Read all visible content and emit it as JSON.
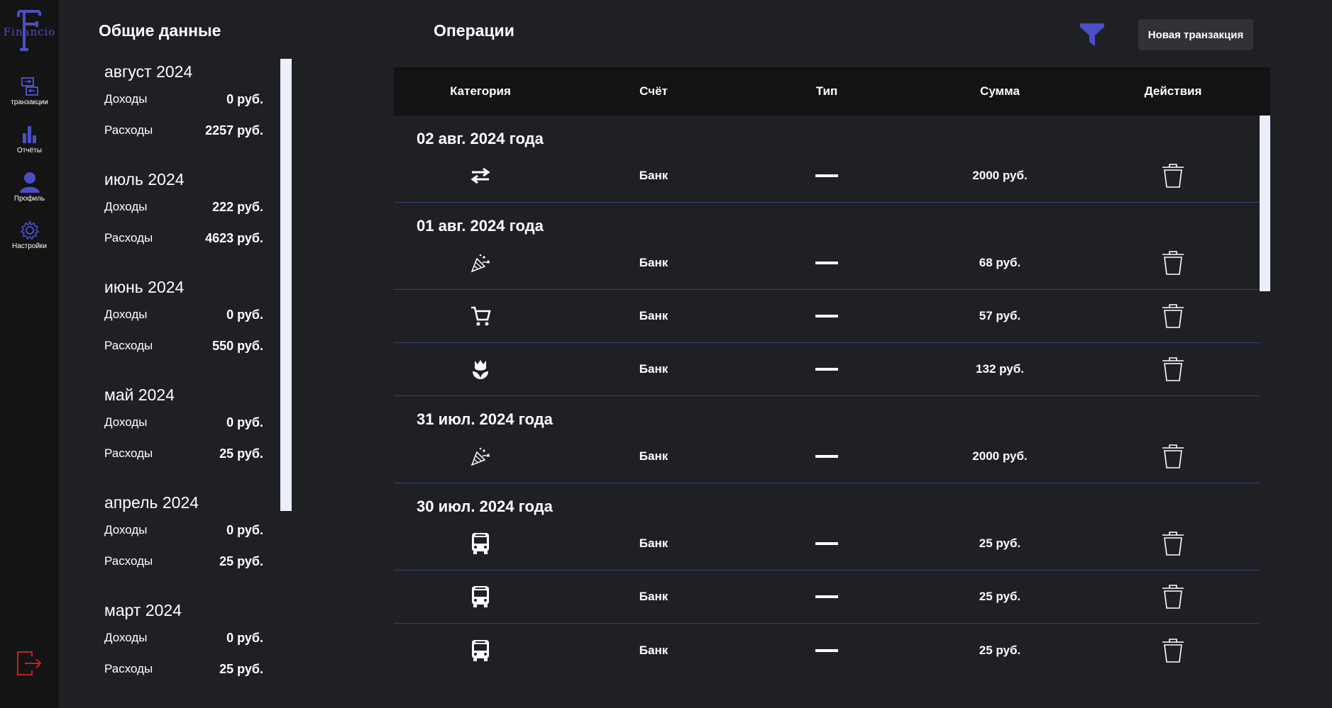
{
  "app": {
    "logo_text": "Financio",
    "logo_letter": "F",
    "accent": "#4b4fc6",
    "danger": "#c8201f"
  },
  "sidebar": {
    "items": [
      {
        "label": "транзакции",
        "icon": "transactions-icon"
      },
      {
        "label": "Отчёты",
        "icon": "bar-chart-icon"
      },
      {
        "label": "Профиль",
        "icon": "user-icon"
      },
      {
        "label": "Настройки",
        "icon": "gear-icon"
      }
    ],
    "logout_icon": "logout-icon"
  },
  "summary": {
    "title": "Общие данные",
    "months": [
      {
        "name": "август 2024",
        "income_label": "Доходы",
        "income": "0 руб.",
        "expense_label": "Расходы",
        "expense": "2257 руб."
      },
      {
        "name": "июль 2024",
        "income_label": "Доходы",
        "income": "222 руб.",
        "expense_label": "Расходы",
        "expense": "4623 руб."
      },
      {
        "name": "июнь 2024",
        "income_label": "Доходы",
        "income": "0 руб.",
        "expense_label": "Расходы",
        "expense": "550 руб."
      },
      {
        "name": "май 2024",
        "income_label": "Доходы",
        "income": "0 руб.",
        "expense_label": "Расходы",
        "expense": "25 руб."
      },
      {
        "name": "апрель 2024",
        "income_label": "Доходы",
        "income": "0 руб.",
        "expense_label": "Расходы",
        "expense": "25 руб."
      },
      {
        "name": "март 2024",
        "income_label": "Доходы",
        "income": "0 руб.",
        "expense_label": "Расходы",
        "expense": "25 руб."
      }
    ]
  },
  "operations": {
    "title": "Операции",
    "filter_icon": "filter-icon",
    "new_button": "Новая транзакция",
    "columns": [
      "Категория",
      "Счёт",
      "Тип",
      "Сумма",
      "Действия"
    ],
    "groups": [
      {
        "date": "02 авг. 2024 года",
        "rows": [
          {
            "category_icon": "transfer-icon",
            "account": "Банк",
            "type": "expense",
            "amount": "2000 руб."
          }
        ]
      },
      {
        "date": "01 авг. 2024 года",
        "rows": [
          {
            "category_icon": "party-popper-icon",
            "account": "Банк",
            "type": "expense",
            "amount": "68 руб."
          },
          {
            "category_icon": "cart-icon",
            "account": "Банк",
            "type": "expense",
            "amount": "57 руб."
          },
          {
            "category_icon": "tulip-icon",
            "account": "Банк",
            "type": "expense",
            "amount": "132 руб."
          }
        ]
      },
      {
        "date": "31 июл. 2024 года",
        "rows": [
          {
            "category_icon": "party-popper-icon",
            "account": "Банк",
            "type": "expense",
            "amount": "2000 руб."
          }
        ]
      },
      {
        "date": "30 июл. 2024 года",
        "rows": [
          {
            "category_icon": "bus-icon",
            "account": "Банк",
            "type": "expense",
            "amount": "25 руб."
          },
          {
            "category_icon": "bus-icon",
            "account": "Банк",
            "type": "expense",
            "amount": "25 руб."
          },
          {
            "category_icon": "bus-icon",
            "account": "Банк",
            "type": "expense",
            "amount": "25 руб."
          }
        ]
      }
    ]
  }
}
